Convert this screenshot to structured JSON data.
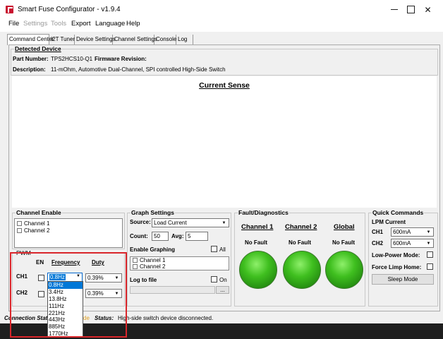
{
  "window": {
    "title": "Smart Fuse Configurator - v1.9.4"
  },
  "menu": [
    "File",
    "Settings",
    "Tools",
    "Export",
    "Language",
    "Help"
  ],
  "tabs": [
    "Command Center",
    "I2T Tuner",
    "Device Settings",
    "Channel Settings",
    "Console",
    "Log"
  ],
  "device": {
    "group_title": "Detected Device",
    "part_number_label": "Part Number:",
    "part_number": "TPS2HCS10-Q1",
    "firmware_label": "Firmware Revision:",
    "description_label": "Description:",
    "description": "11-mOhm, Automotive Dual-Channel, SPI controlled High-Side Switch"
  },
  "plot": {
    "title": "Current Sense"
  },
  "channel_enable": {
    "title": "Channel Enable",
    "items": [
      "Channel 1",
      "Channel 2"
    ]
  },
  "graph": {
    "title": "Graph Settings",
    "source_label": "Source:",
    "source": "Load Current",
    "count_label": "Count:",
    "count": "50",
    "avg_label": "Avg:",
    "avg": "5",
    "enable_label": "Enable Graphing",
    "all_label": "All",
    "channels": [
      "Channel 1",
      "Channel 2"
    ],
    "log_label": "Log to file",
    "on_label": "On",
    "browse_label": "..."
  },
  "fault": {
    "title": "Fault/Diagnostics",
    "columns": [
      {
        "header": "Channel 1",
        "status": "No Fault"
      },
      {
        "header": "Channel 2",
        "status": "No Fault"
      },
      {
        "header": "Global",
        "status": "No Fault"
      }
    ]
  },
  "quick": {
    "title": "Quick Commands",
    "lpm_label": "LPM Current",
    "ch1_label": "CH1",
    "ch1_value": "600mA",
    "ch2_label": "CH2",
    "ch2_value": "600mA",
    "lpm_mode_label": "Low-Power Mode:",
    "limp_label": "Force Limp Home:",
    "sleep_label": "Sleep Mode"
  },
  "pwm": {
    "title": "PWM",
    "en_header": "EN",
    "freq_header": "Frequency",
    "duty_header": "Duty",
    "ch1_label": "CH1",
    "ch2_label": "CH2",
    "ch1_freq": "0.8Hz",
    "ch1_duty": "0.39%",
    "ch2_duty": "0.39%",
    "freq_options": [
      "0.8Hz",
      "3.4Hz",
      "13.8Hz",
      "111Hz",
      "221Hz",
      "443Hz",
      "885Hz",
      "1770Hz"
    ]
  },
  "status": {
    "connection_label": "Connection Stat",
    "mode_fragment": "de",
    "status_label": "Status:",
    "message": "High-side switch device disconnected."
  },
  "colors": {
    "highlight": "#d9262b",
    "led": "#3fbf1f",
    "selection": "#0078d7"
  }
}
